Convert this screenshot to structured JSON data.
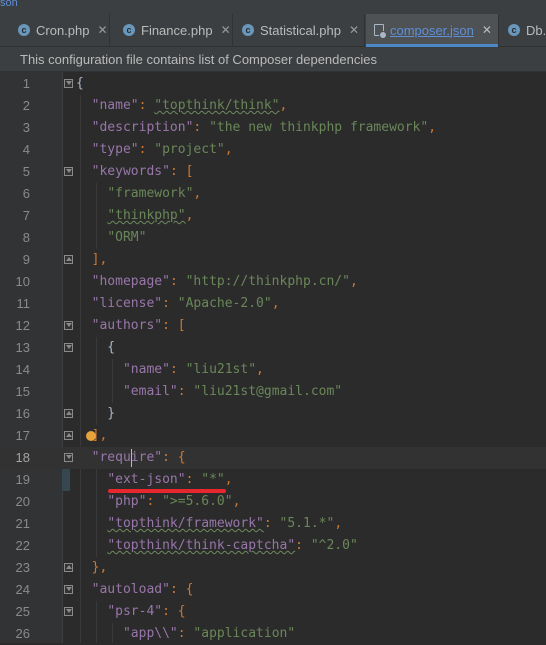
{
  "top_strip_text": "son",
  "tabs": [
    {
      "label": "Cron.php",
      "icon": "php-file-icon",
      "active": false
    },
    {
      "label": "Finance.php",
      "icon": "php-file-icon",
      "active": false
    },
    {
      "label": "Statistical.php",
      "icon": "php-file-icon",
      "active": false
    },
    {
      "label": "composer.json",
      "icon": "json-file-icon",
      "active": true
    },
    {
      "label": "Db.",
      "icon": "php-file-icon",
      "active": false
    }
  ],
  "close_glyph": "✕",
  "banner": "This configuration file contains list of Composer dependencies",
  "lines": [
    {
      "n": "1"
    },
    {
      "n": "2"
    },
    {
      "n": "3"
    },
    {
      "n": "4"
    },
    {
      "n": "5"
    },
    {
      "n": "6"
    },
    {
      "n": "7"
    },
    {
      "n": "8"
    },
    {
      "n": "9"
    },
    {
      "n": "10"
    },
    {
      "n": "11"
    },
    {
      "n": "12"
    },
    {
      "n": "13"
    },
    {
      "n": "14"
    },
    {
      "n": "15"
    },
    {
      "n": "16"
    },
    {
      "n": "17"
    },
    {
      "n": "18"
    },
    {
      "n": "19"
    },
    {
      "n": "20"
    },
    {
      "n": "21"
    },
    {
      "n": "22"
    },
    {
      "n": "23"
    },
    {
      "n": "24"
    },
    {
      "n": "25"
    },
    {
      "n": "26"
    }
  ],
  "code": {
    "name_key": "\"name\"",
    "name_val": "\"topthink/think\"",
    "desc_key": "\"description\"",
    "desc_val": "\"the new thinkphp framework\"",
    "type_key": "\"type\"",
    "type_val": "\"project\"",
    "keywords_key": "\"keywords\"",
    "kw1": "\"framework\"",
    "kw2": "\"thinkphp\"",
    "kw3": "\"ORM\"",
    "homepage_key": "\"homepage\"",
    "homepage_val": "\"http://thinkphp.cn/\"",
    "license_key": "\"license\"",
    "license_val": "\"Apache-2.0\"",
    "authors_key": "\"authors\"",
    "aname_key": "\"name\"",
    "aname_val": "\"liu21st\"",
    "email_key": "\"email\"",
    "email_val": "\"liu21st@gmail.com\"",
    "require_key_a": "\"requ",
    "require_key_b": "ire\"",
    "extjson_key": "\"ext-json\"",
    "extjson_val": "\"*\"",
    "php_key": "\"php\"",
    "php_val": "\">=5.6.0\"",
    "fw_key": "\"topthink/framework\"",
    "fw_val": "\"5.1.*\"",
    "cap_key": "\"topthink/think-captcha\"",
    "cap_val": "\"^2.0\"",
    "autoload_key": "\"autoload\"",
    "psr_key": "\"psr-4\"",
    "app_key": "\"app\\\\\"",
    "app_val": "\"application\""
  },
  "colors": {
    "key": "#9876aa",
    "string": "#6a8759",
    "punct": "#cc7832",
    "text": "#a9b7c6",
    "annotation_line": "#e8262e",
    "bulb": "#e8a33d",
    "active_tab": "#5f8fd6"
  }
}
